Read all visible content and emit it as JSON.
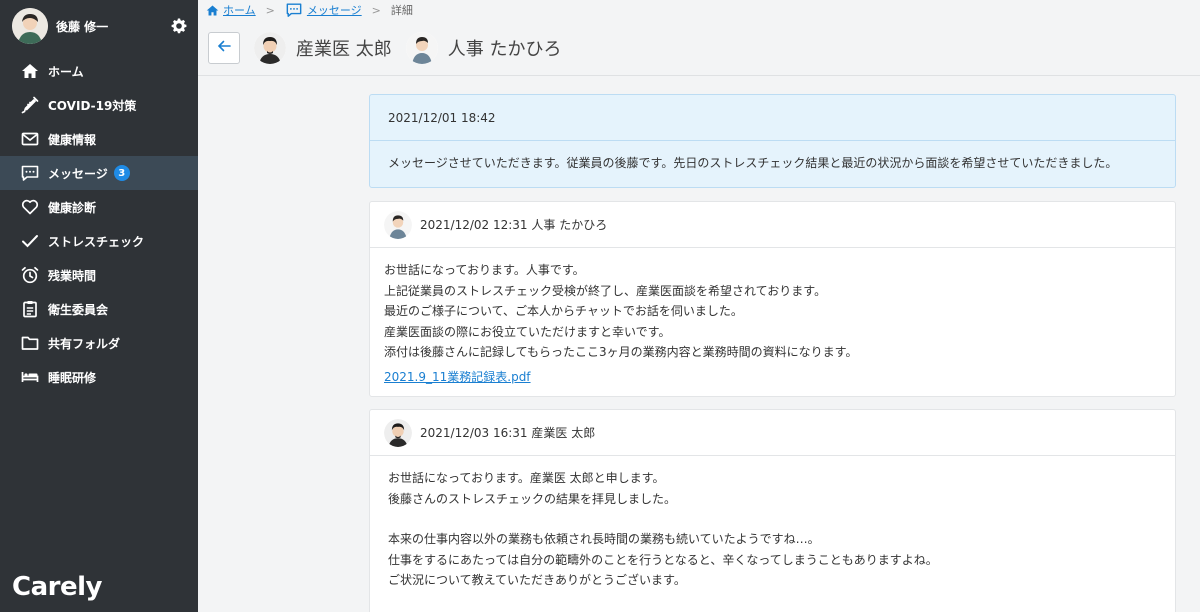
{
  "user": {
    "name": "後藤 修一"
  },
  "nav": [
    {
      "label": "ホーム",
      "icon": "home-icon"
    },
    {
      "label": "COVID-19対策",
      "icon": "syringe-icon"
    },
    {
      "label": "健康情報",
      "icon": "mail-icon"
    },
    {
      "label": "メッセージ",
      "icon": "chat-icon",
      "badge": "3",
      "active": true
    },
    {
      "label": "健康診断",
      "icon": "heart-icon"
    },
    {
      "label": "ストレスチェック",
      "icon": "check-icon"
    },
    {
      "label": "残業時間",
      "icon": "alarm-icon"
    },
    {
      "label": "衛生委員会",
      "icon": "clipboard-icon"
    },
    {
      "label": "共有フォルダ",
      "icon": "folder-icon"
    },
    {
      "label": "睡眠研修",
      "icon": "bed-icon"
    }
  ],
  "logo": "Carely",
  "breadcrumb": {
    "home": "ホーム",
    "messages": "メッセージ",
    "current": "詳細"
  },
  "participants": [
    {
      "name": "産業医 太郎"
    },
    {
      "name": "人事 たかひろ"
    }
  ],
  "messages": [
    {
      "header": "2021/12/01 18:42",
      "lines": [
        "メッセージさせていただきます。従業員の後藤です。先日のストレスチェック結果と最近の状況から面談を希望させていただきました。"
      ]
    },
    {
      "header": "2021/12/02 12:31 人事 たかひろ",
      "lines": [
        "お世話になっております。人事です。",
        "上記従業員のストレスチェック受検が終了し、産業医面談を希望されております。",
        "最近のご様子について、ご本人からチャットでお話を伺いました。",
        "産業医面談の際にお役立ていただけますと幸いです。",
        "添付は後藤さんに記録してもらったここ3ヶ月の業務内容と業務時間の資料になります。"
      ],
      "attachment": "2021.9_11業務記録表.pdf"
    },
    {
      "header": "2021/12/03 16:31 産業医 太郎",
      "lines": [
        "お世話になっております。産業医 太郎と申します。",
        "後藤さんのストレスチェックの結果を拝見しました。",
        "",
        "本来の仕事内容以外の業務も依頼され長時間の業務も続いていたようですね…。",
        "仕事をするにあたっては自分の範疇外のことを行うとなると、辛くなってしまうこともありますよね。",
        "ご状況について教えていただきありがとうございます。"
      ]
    }
  ],
  "colors": {
    "sidebar": "#2f3337",
    "accent": "#1a7fd1",
    "badge": "#1f8be5",
    "first_msg_bg": "#e5f3fc"
  }
}
